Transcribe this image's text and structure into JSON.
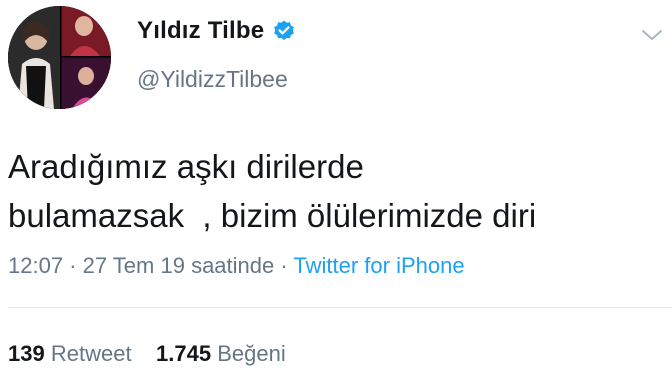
{
  "author": {
    "display_name": "Yıldız Tilbe",
    "handle": "@YildizzTilbee",
    "verified": true
  },
  "icons": {
    "verified": "verified-badge-icon",
    "menu": "chevron-down-icon"
  },
  "tweet": {
    "text_line1": "Aradığımız aşkı dirilerde",
    "text_line2": "bulamazsak  , bizim ölülerimizde diri"
  },
  "meta": {
    "time": "12:07",
    "sep1": " · ",
    "date": "27 Tem 19 saatinde",
    "sep2": " · ",
    "source": "Twitter for iPhone"
  },
  "stats": {
    "retweets_count": "139",
    "retweets_label": "Retweet",
    "likes_count": "1.745",
    "likes_label": "Beğeni"
  },
  "colors": {
    "primary_text": "#14171a",
    "secondary_text": "#657786",
    "accent": "#1da1f2",
    "divider": "#e1e8ed"
  }
}
